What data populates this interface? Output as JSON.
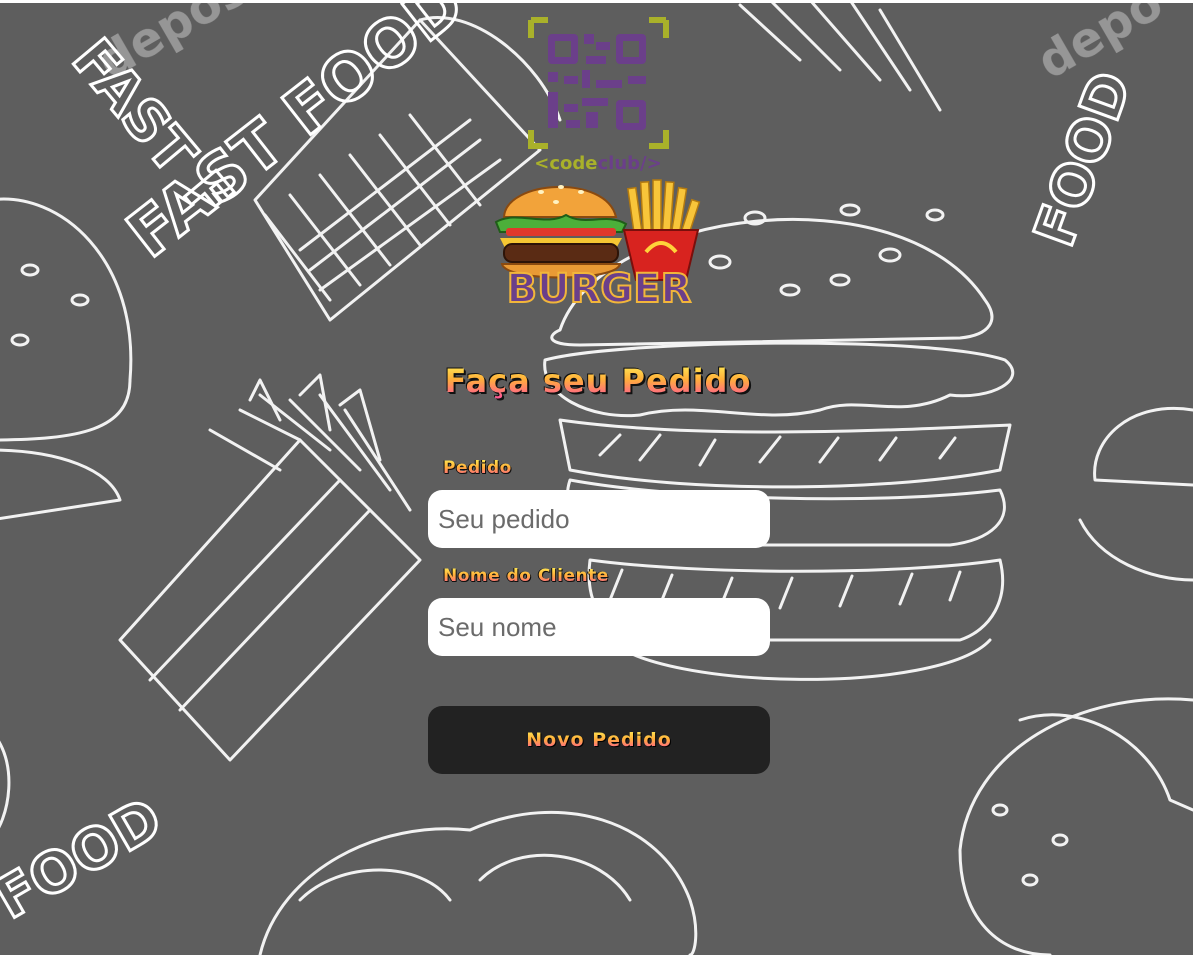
{
  "colors": {
    "background": "#5e5e5e",
    "sketch_lines": "#ffffff",
    "button_bg": "#222222",
    "input_bg": "#ffffff",
    "gradient_top": "#fff45a",
    "gradient_mid": "#ffb03a",
    "gradient_bottom": "#ff4fa0",
    "logo_olive": "#a9b12a",
    "logo_purple": "#6b3f8a"
  },
  "logo": {
    "code_prefix": "<code",
    "club_suffix": "club/>",
    "burger_text": "BURGER",
    "icons": [
      "qr-code-icon",
      "burger-icon",
      "fries-icon"
    ]
  },
  "background": {
    "texts": [
      "FAST FOOD",
      "FOOD",
      "FOOD",
      "FAST F",
      "depos",
      "depo"
    ]
  },
  "form": {
    "title": "Faça seu Pedido",
    "order_label": "Pedido",
    "order_placeholder": "Seu pedido",
    "order_value": "",
    "name_label": "Nome do Cliente",
    "name_placeholder": "Seu nome",
    "name_value": "",
    "submit_label": "Novo Pedido"
  }
}
